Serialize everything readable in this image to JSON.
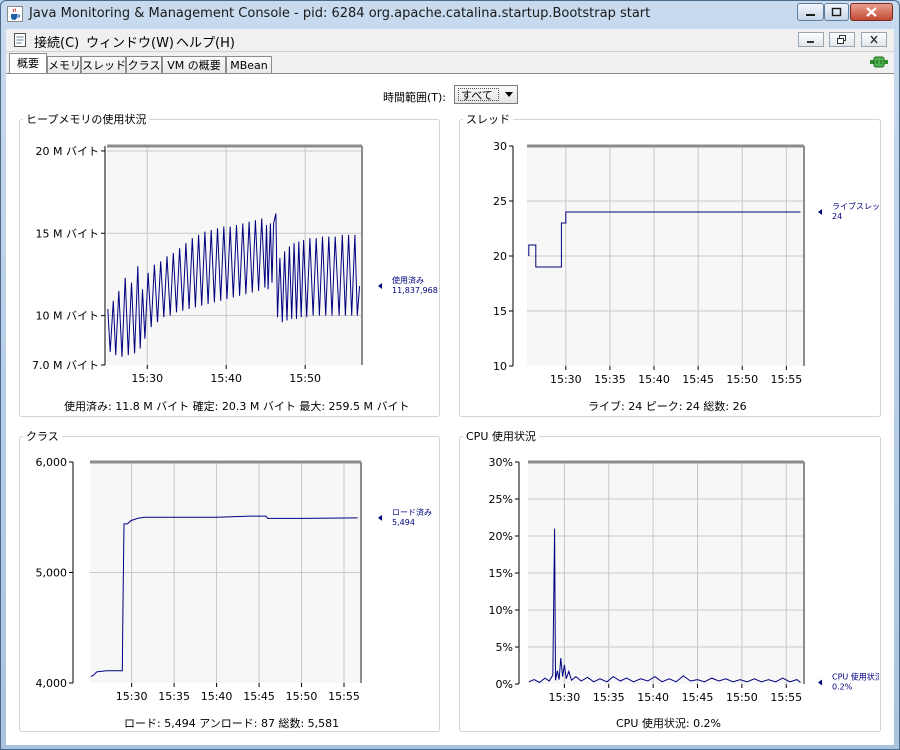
{
  "window": {
    "title": "Java Monitoring & Management Console - pid: 6284 org.apache.catalina.startup.Bootstrap start",
    "icon": "java-coffee-icon"
  },
  "menu": {
    "items": [
      "接続(C)",
      "ウィンドウ(W)",
      "ヘルプ(H)"
    ]
  },
  "tabs": [
    "概要",
    "メモリ",
    "スレッド",
    "クラス",
    "VM の概要",
    "MBean"
  ],
  "active_tab": "概要",
  "time_range": {
    "label": "時間範囲(T):",
    "value": "すべて"
  },
  "colors": {
    "series": "#00007f",
    "grid": "#c8c8c8",
    "plot_bg": "#f7f7f7",
    "axis": "#000000"
  },
  "panels": {
    "heap": {
      "title": "ヒープメモリの使用状況",
      "summary": "使用済み: 11.8 M バイト    確定: 20.3 M バイト    最大: 259.5 M バイト"
    },
    "threads": {
      "title": "スレッド",
      "summary": "ライブ: 24    ピーク: 24    総数: 26"
    },
    "classes": {
      "title": "クラス",
      "summary": "ロード: 5,494    アンロード: 87    総数: 5,581"
    },
    "cpu": {
      "title": "CPU 使用状況",
      "summary": "CPU 使用状況: 0.2%"
    }
  },
  "chart_data": [
    {
      "type": "line",
      "x_unit": "minutes past 15:00",
      "xlim": [
        24.9,
        57.2
      ],
      "ylim": [
        7,
        20.3
      ],
      "y_ticks": [
        7,
        10,
        15,
        20
      ],
      "y_tick_labels": [
        "7.0 M バイト",
        "10 M バイト",
        "15 M バイト",
        "20 M バイト"
      ],
      "x_ticks": [
        30,
        40,
        50
      ],
      "x_tick_labels": [
        "15:30",
        "15:40",
        "15:50"
      ],
      "grid": true,
      "series": [
        {
          "name": "使用済み",
          "latest_label": "11,837,968",
          "points": [
            [
              25.0,
              10.4
            ],
            [
              25.3,
              7.8
            ],
            [
              25.7,
              10.9
            ],
            [
              26.0,
              7.6
            ],
            [
              26.4,
              11.5
            ],
            [
              26.8,
              7.5
            ],
            [
              27.2,
              12.3
            ],
            [
              27.6,
              7.6
            ],
            [
              28.0,
              12.0
            ],
            [
              28.4,
              7.7
            ],
            [
              28.8,
              13.0
            ],
            [
              29.1,
              8.0
            ],
            [
              29.4,
              11.6
            ],
            [
              29.7,
              8.6
            ],
            [
              30.1,
              12.6
            ],
            [
              30.5,
              9.3
            ],
            [
              30.9,
              13.1
            ],
            [
              31.3,
              9.6
            ],
            [
              31.7,
              13.3
            ],
            [
              32.1,
              9.9
            ],
            [
              32.5,
              13.6
            ],
            [
              32.9,
              10.0
            ],
            [
              33.3,
              13.8
            ],
            [
              33.7,
              10.2
            ],
            [
              34.1,
              14.1
            ],
            [
              34.5,
              10.3
            ],
            [
              34.9,
              14.4
            ],
            [
              35.3,
              10.4
            ],
            [
              35.7,
              14.7
            ],
            [
              36.1,
              10.5
            ],
            [
              36.5,
              14.9
            ],
            [
              36.9,
              10.6
            ],
            [
              37.3,
              15.1
            ],
            [
              37.7,
              10.7
            ],
            [
              38.1,
              15.2
            ],
            [
              38.5,
              10.8
            ],
            [
              38.9,
              15.3
            ],
            [
              39.3,
              10.9
            ],
            [
              39.7,
              15.4
            ],
            [
              40.1,
              11.0
            ],
            [
              40.5,
              15.4
            ],
            [
              40.9,
              11.1
            ],
            [
              41.3,
              15.5
            ],
            [
              41.7,
              11.2
            ],
            [
              42.1,
              15.6
            ],
            [
              42.5,
              11.3
            ],
            [
              42.9,
              15.7
            ],
            [
              43.3,
              11.4
            ],
            [
              43.7,
              15.8
            ],
            [
              44.1,
              11.5
            ],
            [
              44.5,
              15.9
            ],
            [
              44.9,
              11.7
            ],
            [
              45.1,
              15.5
            ],
            [
              45.3,
              11.6
            ],
            [
              45.6,
              15.6
            ],
            [
              45.8,
              12.0
            ],
            [
              46.0,
              15.6
            ],
            [
              46.3,
              16.2
            ],
            [
              46.5,
              9.9
            ],
            [
              46.8,
              13.5
            ],
            [
              47.1,
              9.6
            ],
            [
              47.4,
              13.9
            ],
            [
              47.7,
              9.7
            ],
            [
              48.0,
              14.2
            ],
            [
              48.3,
              9.8
            ],
            [
              48.6,
              14.4
            ],
            [
              48.9,
              9.8
            ],
            [
              49.2,
              14.5
            ],
            [
              49.5,
              9.9
            ],
            [
              49.8,
              14.6
            ],
            [
              50.2,
              9.9
            ],
            [
              50.6,
              14.7
            ],
            [
              51.0,
              10.0
            ],
            [
              51.4,
              14.7
            ],
            [
              51.8,
              10.0
            ],
            [
              52.2,
              14.8
            ],
            [
              52.6,
              10.0
            ],
            [
              53.0,
              14.8
            ],
            [
              53.4,
              10.0
            ],
            [
              53.8,
              14.8
            ],
            [
              54.3,
              10.0
            ],
            [
              54.7,
              14.9
            ],
            [
              55.1,
              10.0
            ],
            [
              55.5,
              14.9
            ],
            [
              55.9,
              10.0
            ],
            [
              56.3,
              14.9
            ],
            [
              56.6,
              10.0
            ],
            [
              56.9,
              11.8
            ]
          ]
        }
      ]
    },
    {
      "type": "line",
      "x_unit": "minutes past 15:00",
      "xlim": [
        25.6,
        57.0
      ],
      "ylim": [
        10,
        30
      ],
      "y_ticks": [
        10,
        15,
        20,
        25,
        30
      ],
      "y_tick_labels": [
        "10",
        "15",
        "20",
        "25",
        "30"
      ],
      "x_ticks": [
        30,
        35,
        40,
        45,
        50,
        55
      ],
      "x_tick_labels": [
        "15:30",
        "15:35",
        "15:40",
        "15:45",
        "15:50",
        "15:55"
      ],
      "grid": true,
      "series": [
        {
          "name": "ライブスレッド",
          "latest_label": "24",
          "points": [
            [
              25.8,
              20
            ],
            [
              25.8,
              21
            ],
            [
              26.4,
              21
            ],
            [
              26.4,
              21
            ],
            [
              26.6,
              21
            ],
            [
              26.6,
              19
            ],
            [
              27.0,
              19
            ],
            [
              29.5,
              19
            ],
            [
              29.5,
              23
            ],
            [
              30.0,
              23
            ],
            [
              30.0,
              24
            ],
            [
              56.6,
              24
            ]
          ]
        }
      ]
    },
    {
      "type": "line",
      "x_unit": "minutes past 15:00",
      "xlim": [
        25.1,
        57.0
      ],
      "ylim": [
        4000,
        6000
      ],
      "y_ticks": [
        4000,
        5000,
        6000
      ],
      "y_tick_labels": [
        "4,000",
        "5,000",
        "6,000"
      ],
      "x_ticks": [
        30,
        35,
        40,
        45,
        50,
        55
      ],
      "x_tick_labels": [
        "15:30",
        "15:35",
        "15:40",
        "15:45",
        "15:50",
        "15:55"
      ],
      "grid": true,
      "series": [
        {
          "name": "ロード済み",
          "latest_label": "5,494",
          "points": [
            [
              25.2,
              4060
            ],
            [
              25.5,
              4070
            ],
            [
              25.9,
              4100
            ],
            [
              27.0,
              4110
            ],
            [
              28.9,
              4110
            ],
            [
              29.0,
              4800
            ],
            [
              29.1,
              5440
            ],
            [
              29.5,
              5440
            ],
            [
              29.9,
              5470
            ],
            [
              30.7,
              5490
            ],
            [
              31.5,
              5500
            ],
            [
              34.0,
              5500
            ],
            [
              40.0,
              5500
            ],
            [
              44.0,
              5510
            ],
            [
              45.8,
              5510
            ],
            [
              46.0,
              5490
            ],
            [
              50.0,
              5490
            ],
            [
              56.6,
              5494
            ]
          ]
        }
      ]
    },
    {
      "type": "line",
      "x_unit": "minutes past 15:00",
      "xlim": [
        25.9,
        57.0
      ],
      "ylim": [
        0,
        30
      ],
      "y_ticks": [
        0,
        5,
        10,
        15,
        20,
        25,
        30
      ],
      "y_tick_labels": [
        "0%",
        "5%",
        "10%",
        "15%",
        "20%",
        "25%",
        "30%"
      ],
      "x_ticks": [
        30,
        35,
        40,
        45,
        50,
        55
      ],
      "x_tick_labels": [
        "15:30",
        "15:35",
        "15:40",
        "15:45",
        "15:50",
        "15:55"
      ],
      "grid": true,
      "series": [
        {
          "name": "CPU 使用状況",
          "latest_label": "0.2%",
          "points": [
            [
              26.0,
              0.3
            ],
            [
              26.6,
              0.6
            ],
            [
              27.2,
              0.2
            ],
            [
              27.8,
              0.8
            ],
            [
              28.3,
              0.4
            ],
            [
              28.7,
              1.2
            ],
            [
              28.9,
              21.0
            ],
            [
              29.0,
              0.5
            ],
            [
              29.2,
              1.8
            ],
            [
              29.4,
              0.6
            ],
            [
              29.6,
              3.5
            ],
            [
              29.8,
              1.0
            ],
            [
              30.0,
              2.6
            ],
            [
              30.2,
              0.7
            ],
            [
              30.5,
              1.7
            ],
            [
              30.8,
              0.5
            ],
            [
              31.3,
              1.0
            ],
            [
              31.9,
              0.4
            ],
            [
              32.6,
              0.9
            ],
            [
              33.3,
              0.3
            ],
            [
              34.0,
              0.7
            ],
            [
              34.8,
              0.3
            ],
            [
              35.5,
              1.0
            ],
            [
              36.3,
              0.4
            ],
            [
              37.0,
              0.8
            ],
            [
              37.8,
              0.3
            ],
            [
              38.6,
              0.7
            ],
            [
              39.4,
              0.4
            ],
            [
              40.2,
              1.0
            ],
            [
              41.0,
              0.3
            ],
            [
              41.8,
              0.7
            ],
            [
              42.6,
              0.3
            ],
            [
              43.4,
              1.1
            ],
            [
              44.2,
              0.4
            ],
            [
              45.0,
              0.6
            ],
            [
              45.8,
              0.3
            ],
            [
              46.6,
              0.8
            ],
            [
              47.4,
              0.4
            ],
            [
              48.2,
              0.7
            ],
            [
              49.0,
              0.3
            ],
            [
              49.8,
              0.6
            ],
            [
              50.6,
              0.3
            ],
            [
              51.4,
              0.7
            ],
            [
              52.2,
              0.3
            ],
            [
              53.0,
              0.6
            ],
            [
              53.8,
              0.3
            ],
            [
              54.6,
              0.8
            ],
            [
              55.4,
              0.3
            ],
            [
              56.2,
              0.6
            ],
            [
              56.6,
              0.2
            ]
          ]
        }
      ]
    }
  ]
}
